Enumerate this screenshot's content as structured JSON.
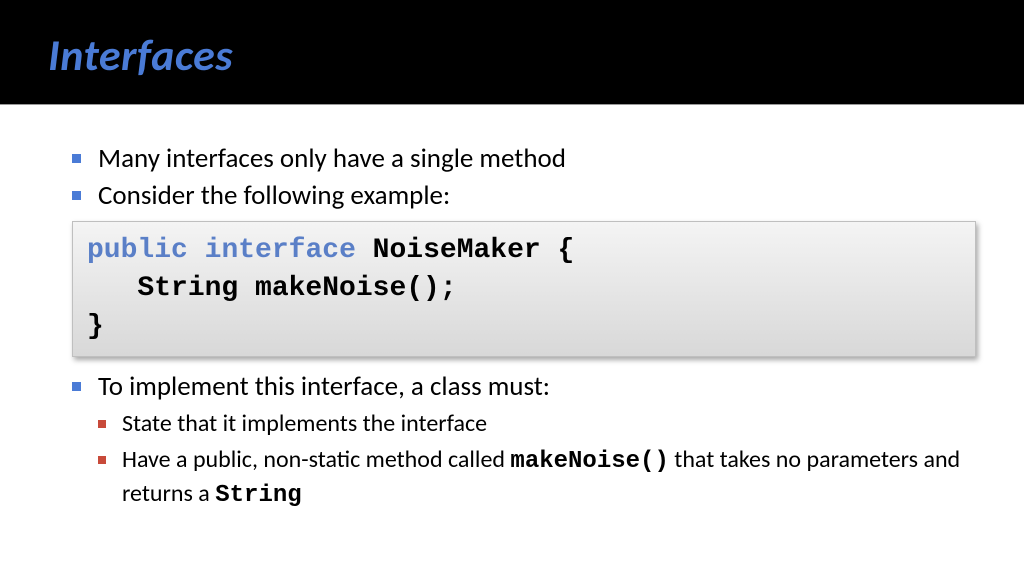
{
  "title": "Interfaces",
  "bullets": {
    "b1": "Many interfaces only have a single method",
    "b2": "Consider the following example:",
    "b3": "To implement this interface, a class must:",
    "sub1": "State that it implements the interface",
    "sub2_pre": "Have a public, non-static method called ",
    "sub2_code": "makeNoise()",
    "sub2_mid": " that takes no parameters and returns a ",
    "sub2_code2": "String"
  },
  "code": {
    "kw1": "public",
    "kw2": "interface",
    "after_kw": " NoiseMaker {",
    "line2": "   String makeNoise();",
    "line3": "}"
  }
}
